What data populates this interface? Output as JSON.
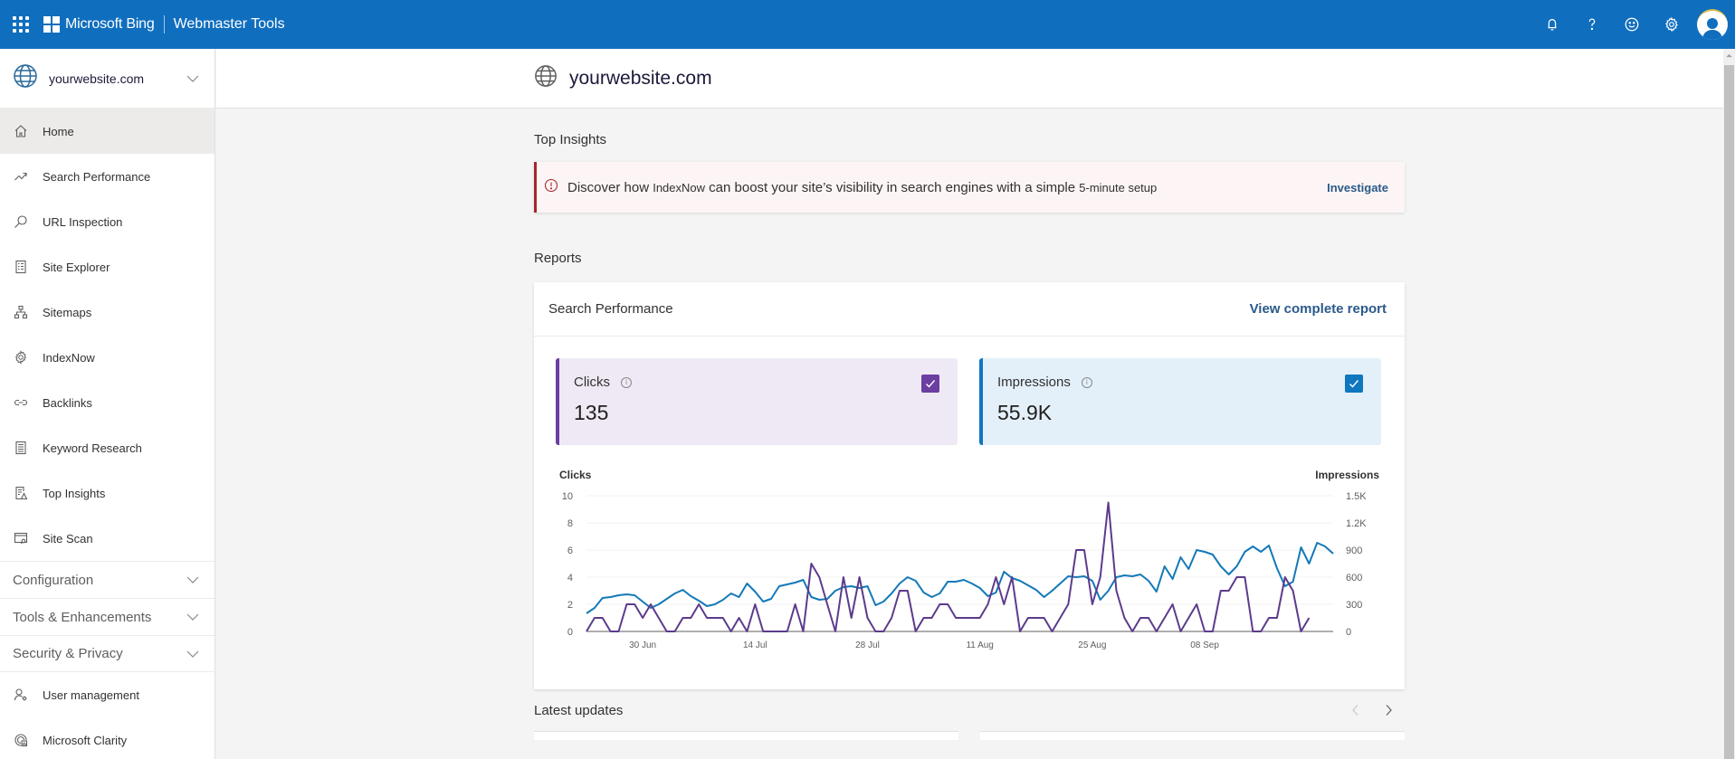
{
  "topbar": {
    "brand": "Microsoft Bing",
    "product": "Webmaster Tools",
    "icons": [
      "waffle-icon",
      "microsoft-logo",
      "bell-icon",
      "help-icon",
      "feedback-smiley-icon",
      "settings-gear-icon",
      "user-avatar"
    ]
  },
  "sidebar": {
    "site": "yourwebsite.com",
    "items": [
      {
        "label": "Home",
        "icon": "home-icon",
        "active": true
      },
      {
        "label": "Search Performance",
        "icon": "trending-up-icon"
      },
      {
        "label": "URL Inspection",
        "icon": "search-icon"
      },
      {
        "label": "Site Explorer",
        "icon": "document-list-icon"
      },
      {
        "label": "Sitemaps",
        "icon": "sitemap-icon"
      },
      {
        "label": "IndexNow",
        "icon": "gear-icon"
      },
      {
        "label": "Backlinks",
        "icon": "link-icon"
      },
      {
        "label": "Keyword Research",
        "icon": "document-lines-icon"
      },
      {
        "label": "Top Insights",
        "icon": "insights-warning-icon"
      },
      {
        "label": "Site Scan",
        "icon": "site-scan-icon"
      }
    ],
    "groups": [
      {
        "label": "Configuration"
      },
      {
        "label": "Tools & Enhancements"
      },
      {
        "label": "Security & Privacy"
      }
    ],
    "bottom_items": [
      {
        "label": "User management",
        "icon": "user-settings-icon"
      },
      {
        "label": "Microsoft Clarity",
        "icon": "clarity-icon"
      }
    ]
  },
  "page": {
    "site_title": "yourwebsite.com",
    "top_insights_title": "Top Insights",
    "insight": {
      "text_before": "Discover how ",
      "bold1": "IndexNow",
      "text_middle": " can boost your site’s visibility in search engines with a simple ",
      "bold2": "5-minute setup",
      "action": "Investigate"
    },
    "reports_title": "Reports",
    "report": {
      "title": "Search Performance",
      "link": "View complete report",
      "metrics": [
        {
          "label": "Clicks",
          "value": "135",
          "checked": true,
          "color": "#6b3fa0"
        },
        {
          "label": "Impressions",
          "value": "55.9K",
          "checked": true,
          "color": "#0f77c0"
        }
      ]
    },
    "latest_updates_title": "Latest updates"
  },
  "chart_data": {
    "type": "line",
    "title": "",
    "ylabel_left": "Clicks",
    "ylabel_right": "Impressions",
    "y_left_ticks": [
      "0",
      "2",
      "4",
      "6",
      "8",
      "10"
    ],
    "y_left_range": [
      0,
      10
    ],
    "y_right_ticks": [
      "0",
      "300",
      "600",
      "900",
      "1.2K",
      "1.5K"
    ],
    "y_right_range": [
      0,
      1500
    ],
    "x_tick_labels": [
      "30 Jun",
      "14 Jul",
      "28 Jul",
      "11 Aug",
      "25 Aug",
      "08 Sep"
    ],
    "x_tick_index": [
      7,
      21,
      35,
      49,
      63,
      77
    ],
    "grid": true,
    "series": [
      {
        "name": "Clicks",
        "axis": "left",
        "color": "#5c3b8c",
        "values": [
          0,
          1,
          1,
          0,
          0,
          2,
          2,
          1,
          2,
          1,
          0,
          0,
          1,
          1,
          2,
          1,
          1,
          1,
          0,
          1,
          0,
          2,
          0,
          0,
          0,
          0,
          2,
          0,
          5,
          4,
          2,
          0,
          4,
          1,
          4,
          1,
          0,
          0,
          1,
          3,
          3,
          0,
          1,
          1,
          2,
          2,
          1,
          1,
          1,
          1,
          2,
          4,
          2,
          4,
          0,
          1,
          1,
          1,
          0,
          1,
          2,
          6,
          6,
          2,
          4,
          9.5,
          3,
          1,
          0,
          1,
          1,
          0,
          1,
          2,
          0,
          1,
          2,
          0,
          0,
          3,
          3,
          4,
          4,
          0,
          0,
          1,
          1,
          4,
          3,
          0,
          1
        ]
      },
      {
        "name": "Impressions",
        "axis": "right",
        "color": "#1479b8",
        "values": [
          200,
          260,
          370,
          380,
          400,
          410,
          400,
          330,
          260,
          300,
          360,
          420,
          460,
          390,
          340,
          280,
          300,
          350,
          420,
          380,
          530,
          440,
          330,
          360,
          500,
          520,
          540,
          570,
          380,
          350,
          360,
          450,
          490,
          500,
          480,
          500,
          290,
          330,
          420,
          530,
          600,
          560,
          430,
          380,
          420,
          550,
          550,
          570,
          530,
          480,
          390,
          430,
          660,
          590,
          560,
          510,
          460,
          380,
          450,
          530,
          610,
          600,
          610,
          560,
          350,
          450,
          600,
          620,
          610,
          630,
          560,
          440,
          720,
          580,
          820,
          690,
          900,
          880,
          850,
          720,
          630,
          720,
          880,
          940,
          880,
          950,
          700,
          500,
          550,
          930,
          750,
          980,
          940,
          860
        ]
      }
    ]
  }
}
